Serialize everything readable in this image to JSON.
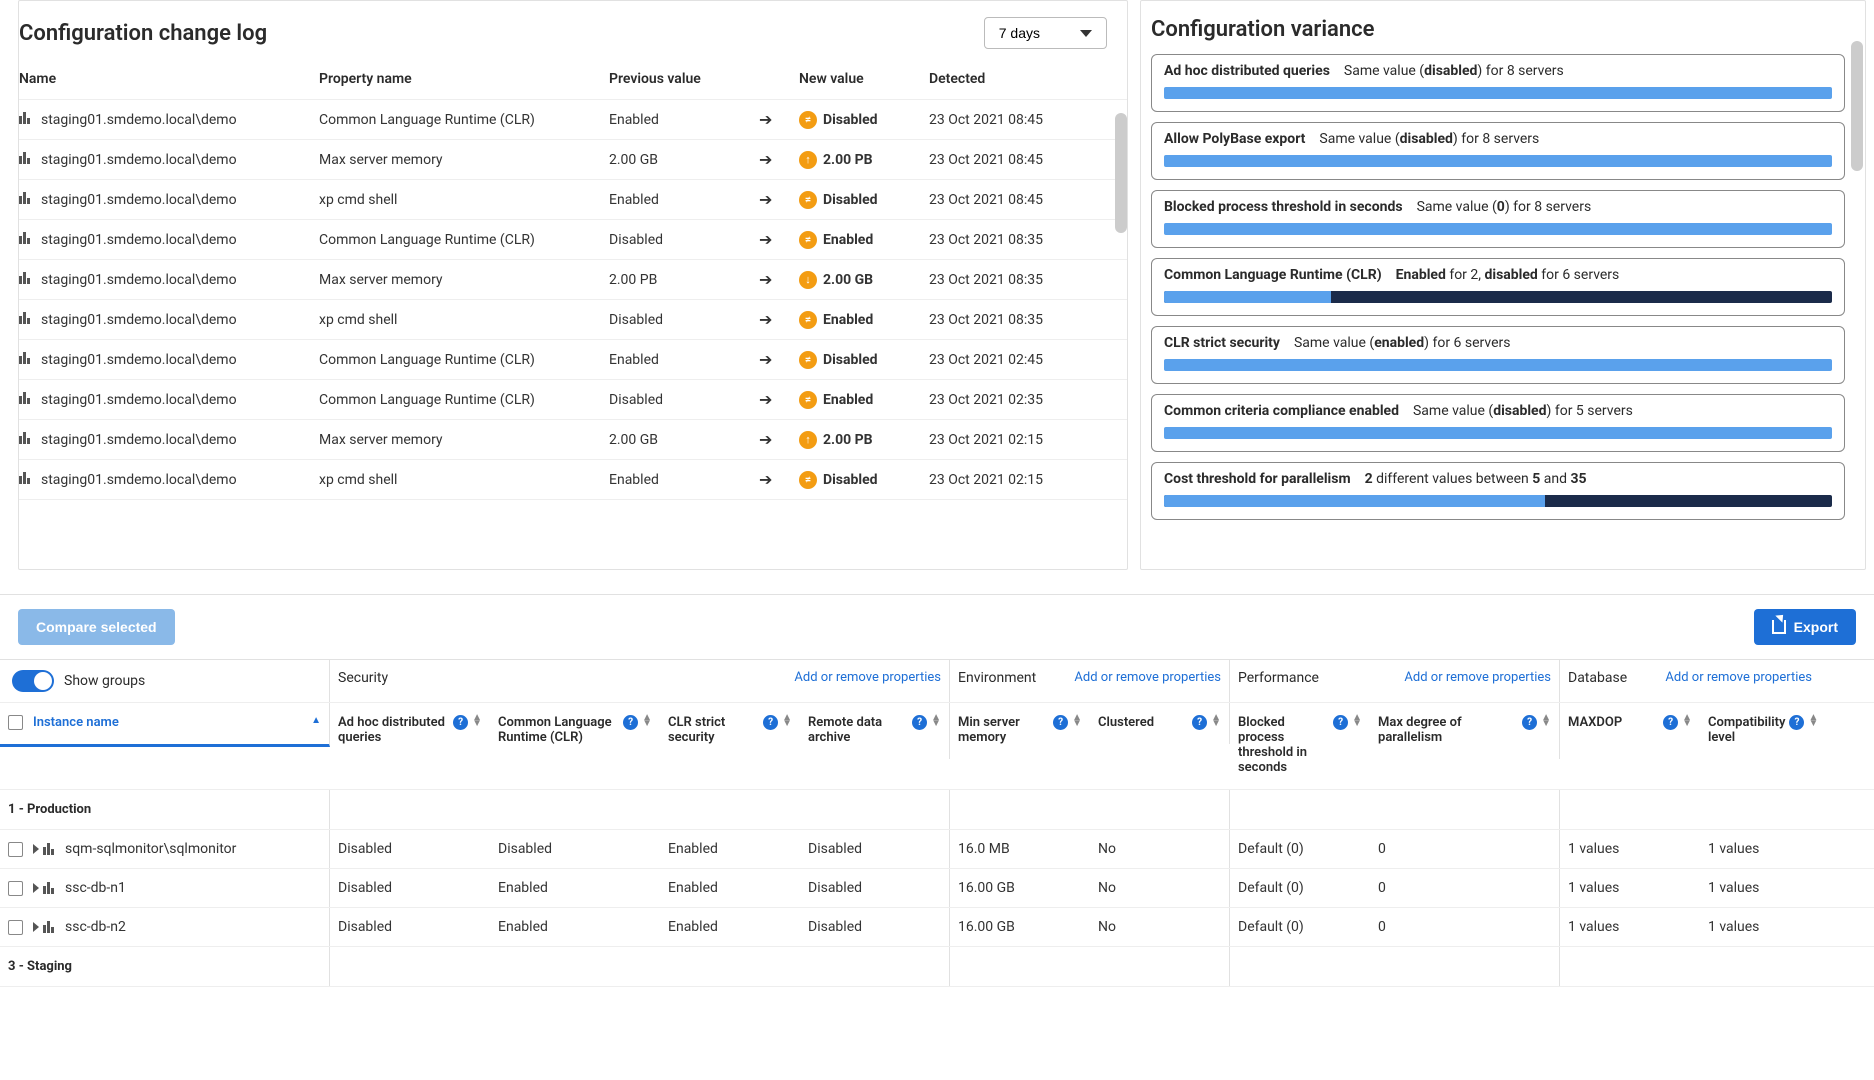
{
  "changelog": {
    "title": "Configuration change log",
    "range_label": "7 days",
    "columns": [
      "Name",
      "Property name",
      "Previous value",
      "New value",
      "Detected"
    ],
    "rows": [
      {
        "name": "staging01.smdemo.local\\demo",
        "prop": "Common Language Runtime (CLR)",
        "prev": "Enabled",
        "badge": "≠",
        "newv": "Disabled",
        "detected": "23 Oct 2021 08:45"
      },
      {
        "name": "staging01.smdemo.local\\demo",
        "prop": "Max server memory",
        "prev": "2.00 GB",
        "badge": "↑",
        "newv": "2.00 PB",
        "detected": "23 Oct 2021 08:45"
      },
      {
        "name": "staging01.smdemo.local\\demo",
        "prop": "xp cmd shell",
        "prev": "Enabled",
        "badge": "≠",
        "newv": "Disabled",
        "detected": "23 Oct 2021 08:45"
      },
      {
        "name": "staging01.smdemo.local\\demo",
        "prop": "Common Language Runtime (CLR)",
        "prev": "Disabled",
        "badge": "≠",
        "newv": "Enabled",
        "detected": "23 Oct 2021 08:35"
      },
      {
        "name": "staging01.smdemo.local\\demo",
        "prop": "Max server memory",
        "prev": "2.00 PB",
        "badge": "↓",
        "newv": "2.00 GB",
        "detected": "23 Oct 2021 08:35"
      },
      {
        "name": "staging01.smdemo.local\\demo",
        "prop": "xp cmd shell",
        "prev": "Disabled",
        "badge": "≠",
        "newv": "Enabled",
        "detected": "23 Oct 2021 08:35"
      },
      {
        "name": "staging01.smdemo.local\\demo",
        "prop": "Common Language Runtime (CLR)",
        "prev": "Enabled",
        "badge": "≠",
        "newv": "Disabled",
        "detected": "23 Oct 2021 02:45"
      },
      {
        "name": "staging01.smdemo.local\\demo",
        "prop": "Common Language Runtime (CLR)",
        "prev": "Disabled",
        "badge": "≠",
        "newv": "Enabled",
        "detected": "23 Oct 2021 02:35"
      },
      {
        "name": "staging01.smdemo.local\\demo",
        "prop": "Max server memory",
        "prev": "2.00 GB",
        "badge": "↑",
        "newv": "2.00 PB",
        "detected": "23 Oct 2021 02:15"
      },
      {
        "name": "staging01.smdemo.local\\demo",
        "prop": "xp cmd shell",
        "prev": "Enabled",
        "badge": "≠",
        "newv": "Disabled",
        "detected": "23 Oct 2021 02:15"
      }
    ]
  },
  "variance": {
    "title": "Configuration variance",
    "cards": [
      {
        "prop": "Ad hoc distributed queries",
        "desc_pre": "Same value (",
        "desc_b": "disabled",
        "desc_post": ") for 8 servers",
        "pct": 100
      },
      {
        "prop": "Allow PolyBase export",
        "desc_pre": "Same value (",
        "desc_b": "disabled",
        "desc_post": ") for 8 servers",
        "pct": 100
      },
      {
        "prop": "Blocked process threshold in seconds",
        "desc_pre": "Same value (",
        "desc_b": "0",
        "desc_post": ") for 8 servers",
        "pct": 100
      },
      {
        "prop": "Common Language Runtime (CLR)",
        "desc_pre": "",
        "desc_b": "Enabled",
        "desc_mid": " for 2, ",
        "desc_b2": "disabled",
        "desc_post": " for 6 servers",
        "pct": 25
      },
      {
        "prop": "CLR strict security",
        "desc_pre": "Same value (",
        "desc_b": "enabled",
        "desc_post": ") for 6 servers",
        "pct": 100
      },
      {
        "prop": "Common criteria compliance enabled",
        "desc_pre": "Same value (",
        "desc_b": "disabled",
        "desc_post": ") for 5 servers",
        "pct": 100
      },
      {
        "prop": "Cost threshold for parallelism",
        "desc_pre": "",
        "desc_b": "2",
        "desc_mid": " different values between ",
        "desc_b2": "5",
        "desc_mid2": " and ",
        "desc_b3": "35",
        "desc_post": "",
        "pct": 57
      }
    ]
  },
  "actions": {
    "compare": "Compare selected",
    "export": "Export",
    "show_groups": "Show groups"
  },
  "grid": {
    "instance_col": "Instance name",
    "sections": {
      "security": {
        "label": "Security",
        "addlink": "Add or remove properties"
      },
      "environment": {
        "label": "Environment",
        "addlink": "Add or remove properties"
      },
      "performance": {
        "label": "Performance",
        "addlink": "Add or remove properties"
      },
      "database": {
        "label": "Database",
        "addlink": "Add or remove properties"
      }
    },
    "cols": {
      "adhoc": "Ad hoc distributed queries",
      "clr": "Common Language Runtime (CLR)",
      "clrstrict": "CLR strict security",
      "remote": "Remote data archive",
      "minmem": "Min server memory",
      "clustered": "Clustered",
      "blocked": "Blocked process threshold in seconds",
      "maxdop_parallel": "Max degree of parallelism",
      "maxdop": "MAXDOP",
      "compat": "Compatibility level"
    },
    "groups": [
      {
        "label": "1 - Production",
        "rows": [
          {
            "name": "sqm-sqlmonitor\\sqlmonitor",
            "adhoc": "Disabled",
            "clr": "Disabled",
            "clrstrict": "Enabled",
            "remote": "Disabled",
            "minmem": "16.0 MB",
            "clustered": "No",
            "blocked": "Default (0)",
            "maxdop_parallel": "0",
            "maxdop": "1 values",
            "compat": "1 values"
          },
          {
            "name": "ssc-db-n1",
            "adhoc": "Disabled",
            "clr": "Enabled",
            "clrstrict": "Enabled",
            "remote": "Disabled",
            "minmem": "16.00 GB",
            "clustered": "No",
            "blocked": "Default (0)",
            "maxdop_parallel": "0",
            "maxdop": "1 values",
            "compat": "1 values"
          },
          {
            "name": "ssc-db-n2",
            "adhoc": "Disabled",
            "clr": "Enabled",
            "clrstrict": "Enabled",
            "remote": "Disabled",
            "minmem": "16.00 GB",
            "clustered": "No",
            "blocked": "Default (0)",
            "maxdop_parallel": "0",
            "maxdop": "1 values",
            "compat": "1 values"
          }
        ]
      },
      {
        "label": "3 - Staging",
        "rows": []
      }
    ]
  }
}
